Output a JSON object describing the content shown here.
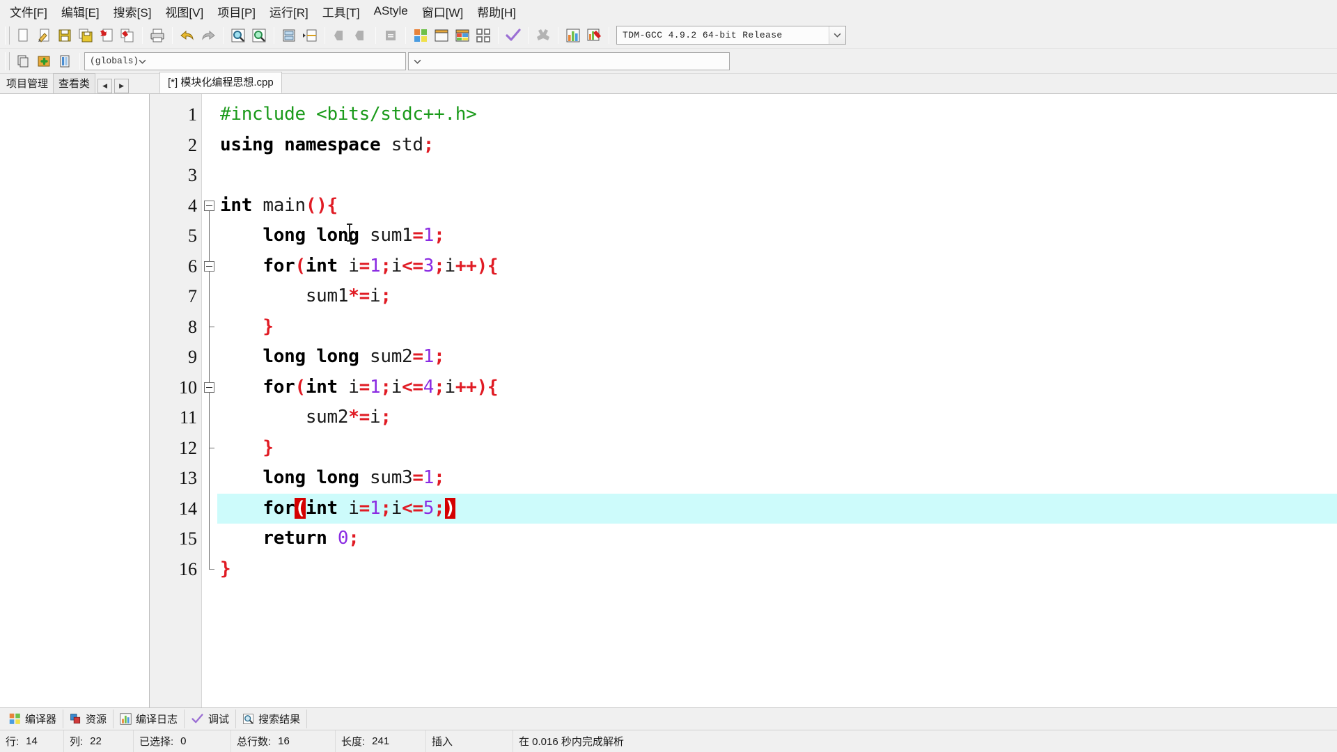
{
  "menubar": {
    "items": [
      {
        "label": "文件[F]",
        "name": "menu-file"
      },
      {
        "label": "编辑[E]",
        "name": "menu-edit"
      },
      {
        "label": "搜索[S]",
        "name": "menu-search"
      },
      {
        "label": "视图[V]",
        "name": "menu-view"
      },
      {
        "label": "项目[P]",
        "name": "menu-project"
      },
      {
        "label": "运行[R]",
        "name": "menu-run"
      },
      {
        "label": "工具[T]",
        "name": "menu-tools"
      },
      {
        "label": "AStyle",
        "name": "menu-astyle"
      },
      {
        "label": "窗口[W]",
        "name": "menu-window"
      },
      {
        "label": "帮助[H]",
        "name": "menu-help"
      }
    ]
  },
  "toolbar": {
    "icons": [
      "new-file-icon",
      "open-file-icon",
      "save-icon",
      "save-all-icon",
      "close-file-icon",
      "close-all-icon",
      "print-icon",
      "undo-icon",
      "redo-icon",
      "find-icon",
      "find-next-icon",
      "goto-line-icon",
      "indent-icon",
      "back-icon",
      "forward-icon",
      "align-icon",
      "compile-icon",
      "run-icon",
      "compile-run-icon",
      "rebuild-icon",
      "syntax-check-icon",
      "stop-icon",
      "profile-icon",
      "delete-profile-icon"
    ],
    "compiler_select": {
      "value": "TDM-GCC 4.9.2 64-bit Release",
      "arrow": "chevron-down-icon"
    }
  },
  "toolbar2": {
    "icons": [
      "new-class-icon",
      "add-member-icon",
      "browse-icon"
    ],
    "scope_select": {
      "value": "(globals)",
      "arrow": "chevron-down-icon"
    },
    "member_select": {
      "value": "",
      "arrow": "chevron-down-icon"
    }
  },
  "tabstrip": {
    "left_tabs": [
      {
        "label": "项目管理",
        "name": "tab-project-manager",
        "active": true
      },
      {
        "label": "查看类",
        "name": "tab-class-browser",
        "active": false
      }
    ],
    "scroll_left": "◀",
    "scroll_right": "▶",
    "document_tab": "[*] 模块化编程思想.cpp"
  },
  "editor": {
    "lines": [
      {
        "num": "1",
        "fold": "none",
        "tokens": [
          {
            "t": "#include <bits/stdc++.h>",
            "c": "pp"
          }
        ]
      },
      {
        "num": "2",
        "fold": "none",
        "tokens": [
          {
            "t": "using",
            "c": "k"
          },
          {
            "t": " ",
            "c": "id"
          },
          {
            "t": "namespace",
            "c": "k"
          },
          {
            "t": " ",
            "c": "id"
          },
          {
            "t": "std",
            "c": "id"
          },
          {
            "t": ";",
            "c": "op"
          }
        ]
      },
      {
        "num": "3",
        "fold": "none",
        "tokens": []
      },
      {
        "num": "4",
        "fold": "open",
        "tokens": [
          {
            "t": "int",
            "c": "k"
          },
          {
            "t": " ",
            "c": "id"
          },
          {
            "t": "main",
            "c": "id"
          },
          {
            "t": "(){",
            "c": "op"
          }
        ]
      },
      {
        "num": "5",
        "fold": "bar",
        "tokens": [
          {
            "t": "    ",
            "c": "id"
          },
          {
            "t": "long",
            "c": "k"
          },
          {
            "t": " ",
            "c": "id"
          },
          {
            "t": "long",
            "c": "k"
          },
          {
            "t": " ",
            "c": "id"
          },
          {
            "t": "sum1",
            "c": "id"
          },
          {
            "t": "=",
            "c": "op"
          },
          {
            "t": "1",
            "c": "num"
          },
          {
            "t": ";",
            "c": "op"
          }
        ]
      },
      {
        "num": "6",
        "fold": "open",
        "tokens": [
          {
            "t": "    ",
            "c": "id"
          },
          {
            "t": "for",
            "c": "k"
          },
          {
            "t": "(",
            "c": "op"
          },
          {
            "t": "int",
            "c": "k"
          },
          {
            "t": " ",
            "c": "id"
          },
          {
            "t": "i",
            "c": "id"
          },
          {
            "t": "=",
            "c": "op"
          },
          {
            "t": "1",
            "c": "num"
          },
          {
            "t": ";",
            "c": "op"
          },
          {
            "t": "i",
            "c": "id"
          },
          {
            "t": "<=",
            "c": "op"
          },
          {
            "t": "3",
            "c": "num"
          },
          {
            "t": ";",
            "c": "op"
          },
          {
            "t": "i",
            "c": "id"
          },
          {
            "t": "++){",
            "c": "op"
          }
        ]
      },
      {
        "num": "7",
        "fold": "bar2",
        "tokens": [
          {
            "t": "        ",
            "c": "id"
          },
          {
            "t": "sum1",
            "c": "id"
          },
          {
            "t": "*=",
            "c": "op"
          },
          {
            "t": "i",
            "c": "id"
          },
          {
            "t": ";",
            "c": "op"
          }
        ]
      },
      {
        "num": "8",
        "fold": "end",
        "tokens": [
          {
            "t": "    ",
            "c": "id"
          },
          {
            "t": "}",
            "c": "op"
          }
        ]
      },
      {
        "num": "9",
        "fold": "bar",
        "tokens": [
          {
            "t": "    ",
            "c": "id"
          },
          {
            "t": "long",
            "c": "k"
          },
          {
            "t": " ",
            "c": "id"
          },
          {
            "t": "long",
            "c": "k"
          },
          {
            "t": " ",
            "c": "id"
          },
          {
            "t": "sum2",
            "c": "id"
          },
          {
            "t": "=",
            "c": "op"
          },
          {
            "t": "1",
            "c": "num"
          },
          {
            "t": ";",
            "c": "op"
          }
        ]
      },
      {
        "num": "10",
        "fold": "open",
        "tokens": [
          {
            "t": "    ",
            "c": "id"
          },
          {
            "t": "for",
            "c": "k"
          },
          {
            "t": "(",
            "c": "op"
          },
          {
            "t": "int",
            "c": "k"
          },
          {
            "t": " ",
            "c": "id"
          },
          {
            "t": "i",
            "c": "id"
          },
          {
            "t": "=",
            "c": "op"
          },
          {
            "t": "1",
            "c": "num"
          },
          {
            "t": ";",
            "c": "op"
          },
          {
            "t": "i",
            "c": "id"
          },
          {
            "t": "<=",
            "c": "op"
          },
          {
            "t": "4",
            "c": "num"
          },
          {
            "t": ";",
            "c": "op"
          },
          {
            "t": "i",
            "c": "id"
          },
          {
            "t": "++){",
            "c": "op"
          }
        ]
      },
      {
        "num": "11",
        "fold": "bar2",
        "tokens": [
          {
            "t": "        ",
            "c": "id"
          },
          {
            "t": "sum2",
            "c": "id"
          },
          {
            "t": "*=",
            "c": "op"
          },
          {
            "t": "i",
            "c": "id"
          },
          {
            "t": ";",
            "c": "op"
          }
        ]
      },
      {
        "num": "12",
        "fold": "end",
        "tokens": [
          {
            "t": "    ",
            "c": "id"
          },
          {
            "t": "}",
            "c": "op"
          }
        ]
      },
      {
        "num": "13",
        "fold": "bar",
        "tokens": [
          {
            "t": "    ",
            "c": "id"
          },
          {
            "t": "long",
            "c": "k"
          },
          {
            "t": " ",
            "c": "id"
          },
          {
            "t": "long",
            "c": "k"
          },
          {
            "t": " ",
            "c": "id"
          },
          {
            "t": "sum3",
            "c": "id"
          },
          {
            "t": "=",
            "c": "op"
          },
          {
            "t": "1",
            "c": "num"
          },
          {
            "t": ";",
            "c": "op"
          }
        ]
      },
      {
        "num": "14",
        "fold": "bar",
        "highlight": true,
        "tokens": [
          {
            "t": "    ",
            "c": "id"
          },
          {
            "t": "for",
            "c": "k"
          },
          {
            "t": "(",
            "c": "mparen"
          },
          {
            "t": "int",
            "c": "k"
          },
          {
            "t": " ",
            "c": "id"
          },
          {
            "t": "i",
            "c": "id"
          },
          {
            "t": "=",
            "c": "op"
          },
          {
            "t": "1",
            "c": "num"
          },
          {
            "t": ";",
            "c": "op"
          },
          {
            "t": "i",
            "c": "id"
          },
          {
            "t": "<=",
            "c": "op"
          },
          {
            "t": "5",
            "c": "num"
          },
          {
            "t": ";",
            "c": "op"
          },
          {
            "t": ")",
            "c": "mparen"
          }
        ]
      },
      {
        "num": "15",
        "fold": "bar",
        "tokens": [
          {
            "t": "    ",
            "c": "id"
          },
          {
            "t": "return",
            "c": "k"
          },
          {
            "t": " ",
            "c": "id"
          },
          {
            "t": "0",
            "c": "num"
          },
          {
            "t": ";",
            "c": "op"
          }
        ]
      },
      {
        "num": "16",
        "fold": "close",
        "tokens": [
          {
            "t": "}",
            "c": "op"
          }
        ]
      }
    ]
  },
  "bottom_tabs": [
    {
      "label": "编译器",
      "icon": "compiler-icon",
      "name": "bottom-tab-compiler"
    },
    {
      "label": "资源",
      "icon": "resources-icon",
      "name": "bottom-tab-resources"
    },
    {
      "label": "编译日志",
      "icon": "compile-log-icon",
      "name": "bottom-tab-compile-log"
    },
    {
      "label": "调试",
      "icon": "debug-icon",
      "name": "bottom-tab-debug"
    },
    {
      "label": "搜索结果",
      "icon": "find-results-icon",
      "name": "bottom-tab-find-results"
    }
  ],
  "statusbar": {
    "row_label": "行:",
    "row_value": "14",
    "col_label": "列:",
    "col_value": "22",
    "sel_label": "已选择:",
    "sel_value": "0",
    "total_label": "总行数:",
    "total_value": "16",
    "len_label": "长度:",
    "len_value": "241",
    "mode": "插入",
    "parse_msg": "在 0.016 秒内完成解析"
  },
  "colors": {
    "highlight_line": "#cdfbfb",
    "match_paren_bg": "#d40000",
    "preprocessor": "#1a9a1a",
    "number": "#8a2be2",
    "operator": "#e01b24",
    "chrome": "#f0f0f0"
  }
}
